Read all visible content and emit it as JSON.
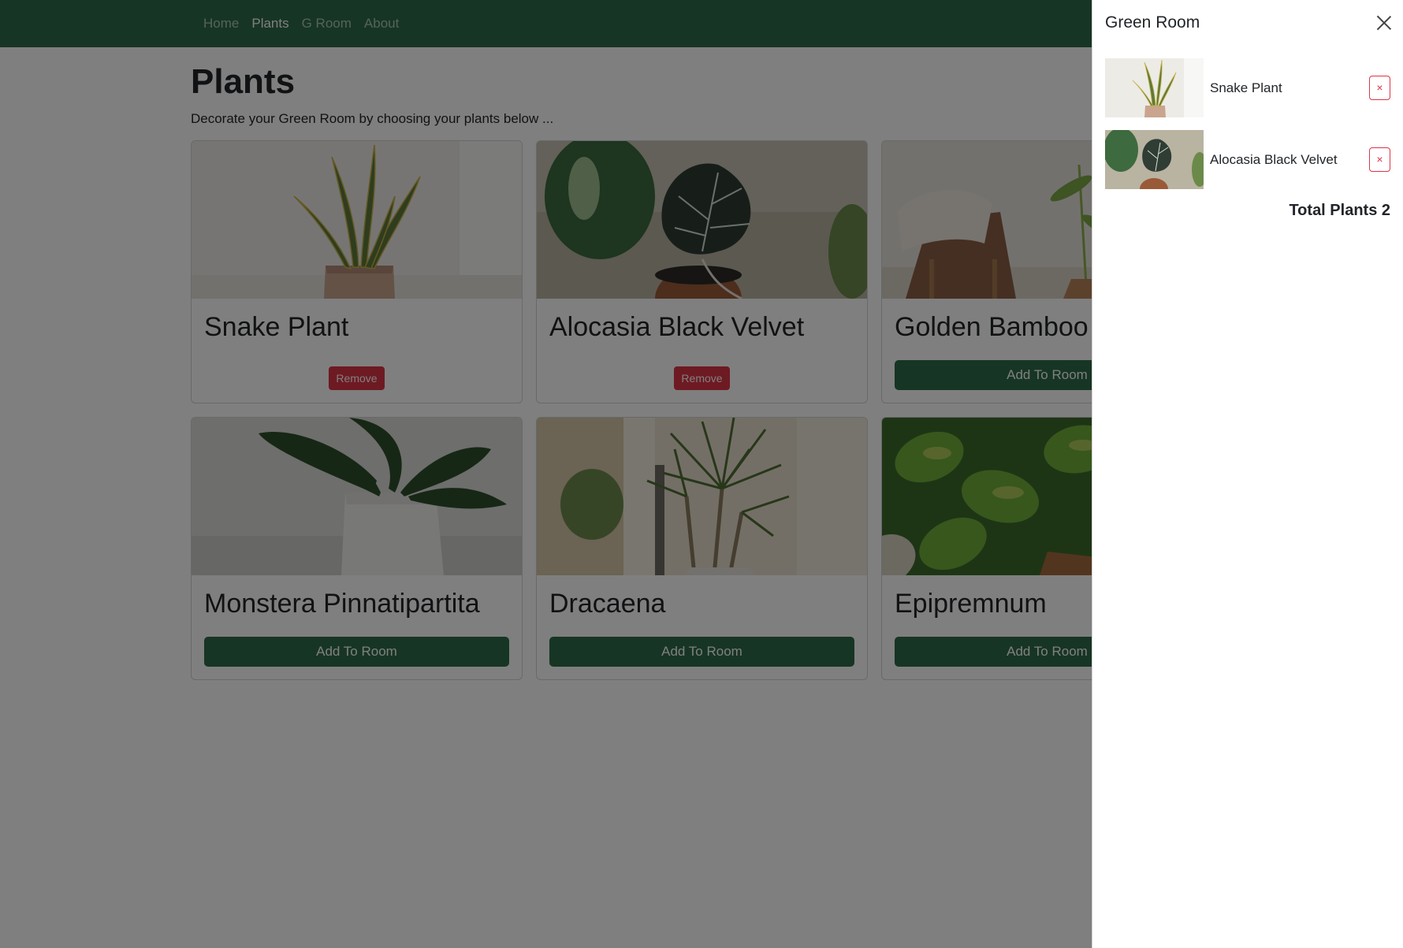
{
  "nav": {
    "items": [
      {
        "label": "Home",
        "active": false
      },
      {
        "label": "Plants",
        "active": true
      },
      {
        "label": "G Room",
        "active": false
      },
      {
        "label": "About",
        "active": false
      }
    ]
  },
  "page": {
    "title": "Plants",
    "subtitle": "Decorate your Green Room by choosing your plants below ..."
  },
  "cards": [
    {
      "name": "Snake Plant",
      "action": "Remove",
      "in_room": true,
      "image": "snake-plant-photo"
    },
    {
      "name": "Alocasia Black Velvet",
      "action": "Remove",
      "in_room": true,
      "image": "alocasia-photo"
    },
    {
      "name": "Golden Bamboo",
      "action": "Add To Room",
      "in_room": false,
      "image": "golden-bamboo-photo"
    },
    {
      "name": "Monstera Pinnatipartita",
      "action": "Add To Room",
      "in_room": false,
      "image": "monstera-photo"
    },
    {
      "name": "Dracaena",
      "action": "Add To Room",
      "in_room": false,
      "image": "dracaena-photo"
    },
    {
      "name": "Epipremnum",
      "action": "Add To Room",
      "in_room": false,
      "image": "epipremnum-photo"
    }
  ],
  "offcanvas": {
    "title": "Green Room",
    "close_icon": "close-icon",
    "items": [
      {
        "name": "Snake Plant",
        "remove_label": "×"
      },
      {
        "name": "Alocasia Black Velvet",
        "remove_label": "×"
      }
    ],
    "total": "Total Plants 2"
  },
  "colors": {
    "brand_green": "#2e6b48",
    "danger": "#dc3545"
  }
}
